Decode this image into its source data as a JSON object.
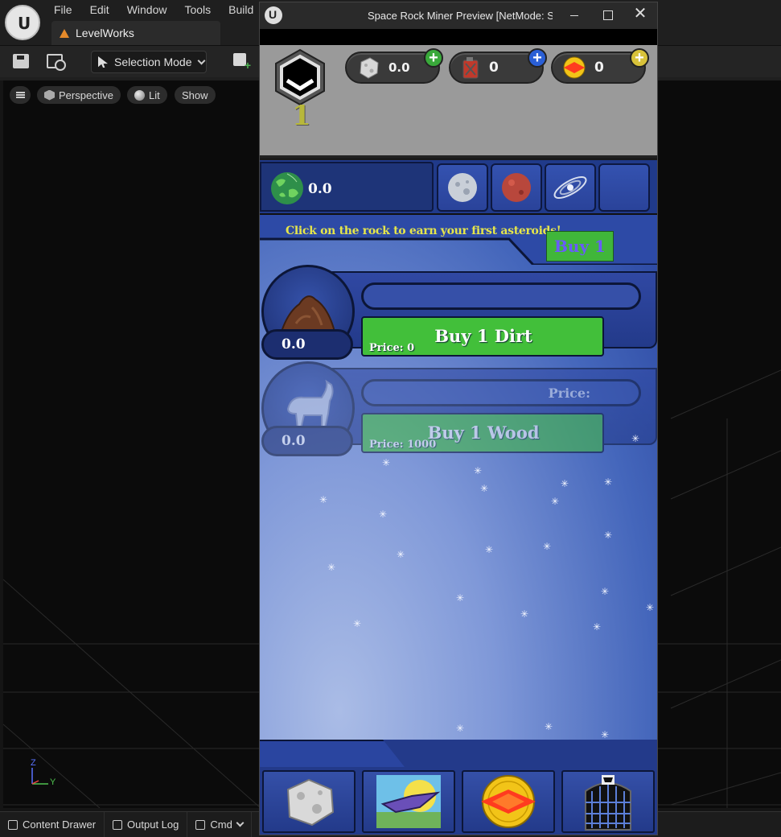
{
  "editor": {
    "menu": [
      "File",
      "Edit",
      "Window",
      "Tools",
      "Build"
    ],
    "level_tab": "LevelWorks",
    "selection_mode": "Selection Mode",
    "viewport": {
      "perspective": "Perspective",
      "lit": "Lit",
      "show": "Show"
    },
    "axes": {
      "z": "Z",
      "y": "Y"
    },
    "statusbar": {
      "content_drawer": "Content Drawer",
      "output_log": "Output Log",
      "cmd": "Cmd"
    }
  },
  "game_window": {
    "title": "Space Rock Miner Preview [NetMode: S",
    "close_glyph": "✕"
  },
  "hud": {
    "level": "1",
    "rocks": "0.0",
    "fuel": "0",
    "tokens": "0",
    "plus": "+"
  },
  "resources": {
    "money": "0.0"
  },
  "hint": "Click on the rock to earn your first asteroids!",
  "buy_multiplier": "Buy 1",
  "producers": [
    {
      "name": "dirt",
      "count": "0.0",
      "bar_price": "",
      "button": "Buy 1 Dirt",
      "price": "Price: 0",
      "locked": false
    },
    {
      "name": "wood",
      "count": "0.0",
      "bar_price": "Price:",
      "button": "Buy 1 Wood",
      "price": "Price: 1000",
      "locked": true
    }
  ],
  "icons": {
    "tabs": [
      "earth-icon",
      "moon-icon",
      "mars-icon",
      "galaxy-icon",
      "empty-slot"
    ],
    "nav": [
      "asteroid-icon",
      "spaceship-icon",
      "compass-icon",
      "shop-icon"
    ]
  },
  "colors": {
    "buy_green": "#42bf3a",
    "space_blue": "#233a8a",
    "hint_yellow": "#e6e64a",
    "plus_green": "#39a93a",
    "plus_blue": "#2a5fd6",
    "plus_yellow": "#d8c23a"
  }
}
